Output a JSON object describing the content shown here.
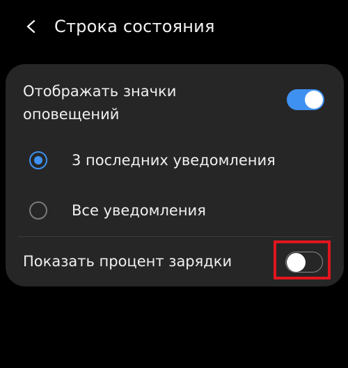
{
  "header": {
    "title": "Строка состояния",
    "back_icon": "chevron-left-icon"
  },
  "settings": {
    "notification_icons": {
      "label": "Отображать значки\nоповещений",
      "enabled": true
    },
    "options": [
      {
        "label": "3 последних уведомления",
        "selected": true
      },
      {
        "label": "Все уведомления",
        "selected": false
      }
    ],
    "battery_percent": {
      "label": "Показать процент зарядки",
      "enabled": false
    }
  },
  "colors": {
    "background": "#000000",
    "card": "#262626",
    "accent": "#3e91f0",
    "highlight": "#e0161e",
    "text": "#f0f0f0"
  }
}
